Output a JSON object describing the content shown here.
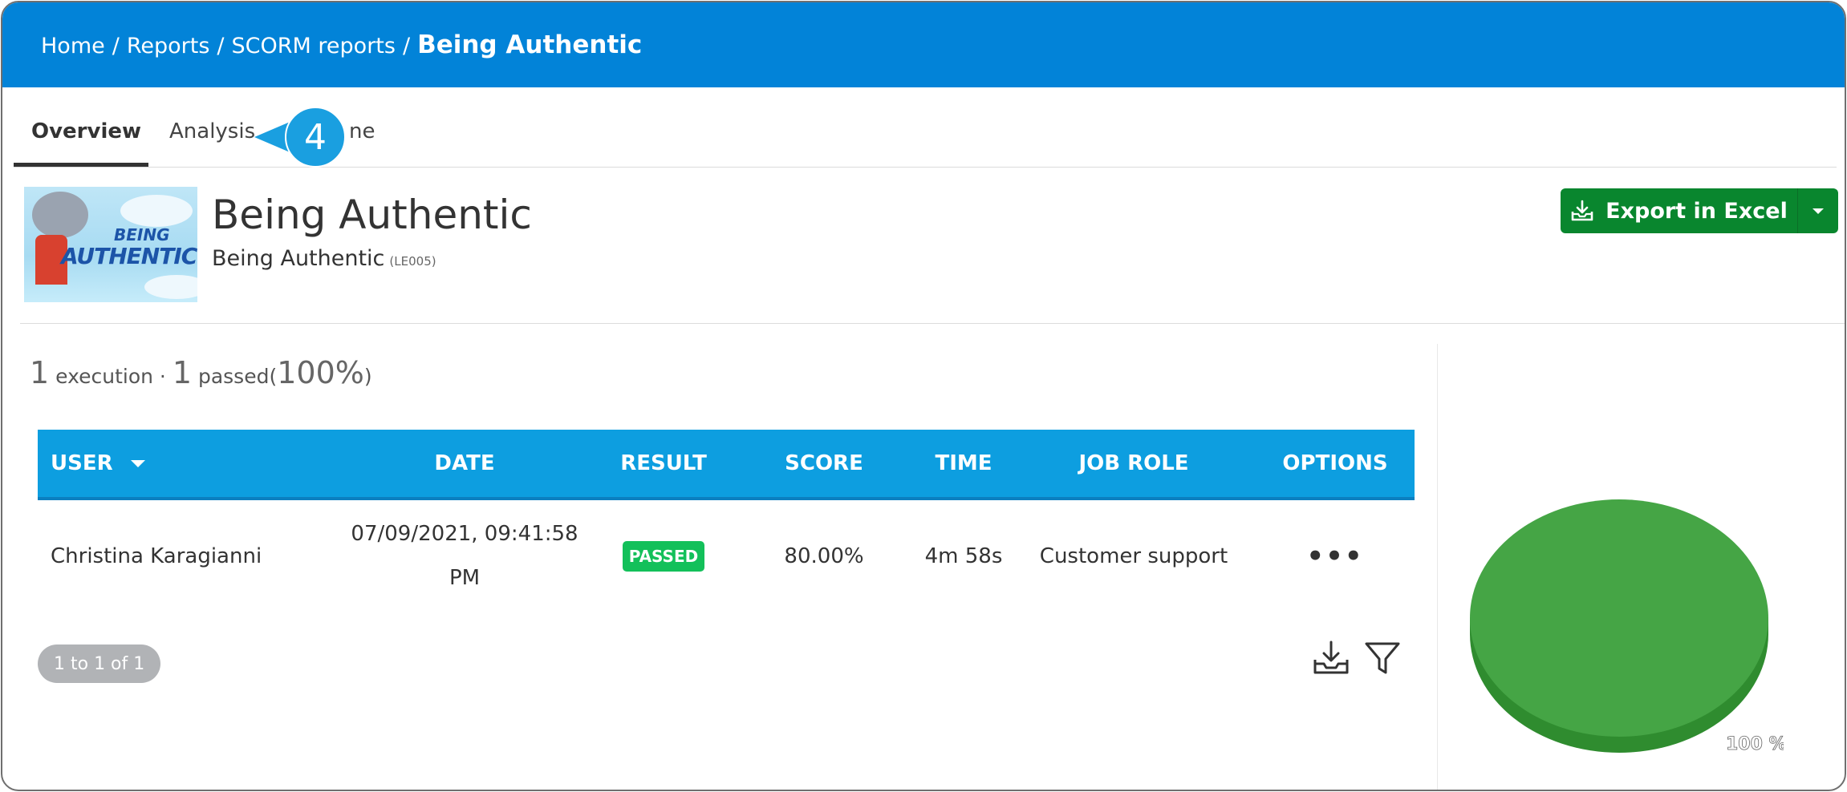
{
  "breadcrumb": {
    "items": [
      "Home",
      "Reports",
      "SCORM reports"
    ],
    "separator": "/",
    "current": "Being Authentic"
  },
  "tabs": [
    {
      "label": "Overview",
      "active": true
    },
    {
      "label": "Analysis",
      "active": false
    },
    {
      "label": "ne",
      "active": false
    }
  ],
  "callout": {
    "number": "4"
  },
  "course": {
    "title": "Being Authentic",
    "subtitle": "Being Authentic",
    "code": "(LE005)",
    "thumbnail_text": [
      "BEING",
      "AUTHENTIC"
    ]
  },
  "export_button": {
    "label": "Export in Excel"
  },
  "summary": {
    "executions": "1",
    "executions_label": "execution",
    "dot": "·",
    "passed": "1",
    "passed_label": "passed",
    "open_paren": "(",
    "percent": "100%",
    "close_paren": ")"
  },
  "table": {
    "columns": [
      "USER",
      "DATE",
      "RESULT",
      "SCORE",
      "TIME",
      "JOB ROLE",
      "OPTIONS"
    ],
    "rows": [
      {
        "user": "Christina Karagianni",
        "date": "07/09/2021, 09:41:58 PM",
        "result": "PASSED",
        "score": "80.00%",
        "time": "4m 58s",
        "job_role": "Customer support",
        "options": "•••"
      }
    ]
  },
  "pager": {
    "label": "1 to 1 of 1"
  },
  "tools": {
    "download_icon": "download-tray-icon",
    "filter_icon": "filter-funnel-icon"
  },
  "pie": {
    "label": "100 %",
    "value_percent": 100,
    "top_color": "#45a545",
    "side_color": "#2f8c2f"
  },
  "colors": {
    "header": "#0283d8",
    "table_header": "#0d9ee0",
    "export": "#09862e",
    "passed_badge": "#13c05a",
    "callout": "#1a9fe0"
  }
}
